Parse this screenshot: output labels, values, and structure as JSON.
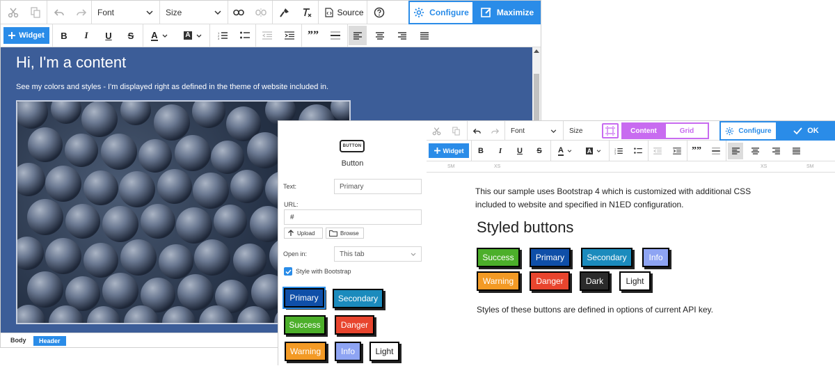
{
  "editor1": {
    "toolbar1": {
      "font_label": "Font",
      "size_label": "Size",
      "source_label": "Source",
      "configure_label": "Configure",
      "maximize_label": "Maximize"
    },
    "toolbar2": {
      "widget_label": "Widget",
      "bold": "B",
      "italic": "I",
      "underline": "U",
      "strike": "S",
      "text_color": "A",
      "bg_color": "A",
      "quote": "””"
    },
    "content": {
      "heading": "Hi, I'm a content",
      "paragraph": "See my colors and styles - I'm displayed right as defined in the theme of website included in."
    },
    "statusbar": {
      "body_label": "Body",
      "header_label": "Header"
    }
  },
  "widget_panel": {
    "icon_text": "BUTTON",
    "title": "Button",
    "text_label": "Text:",
    "text_value": "Primary",
    "url_label": "URL:",
    "url_value": "#",
    "upload_label": "Upload",
    "browse_label": "Browse",
    "open_in_label": "Open in:",
    "open_in_value": "This tab",
    "bootstrap_label": "Style with Bootstrap",
    "bootstrap_checked": true,
    "buttons": [
      {
        "label": "Primary",
        "bg": "#0f4fa8",
        "fg": "#ffffff"
      },
      {
        "label": "Secondary",
        "bg": "#1b8bbd",
        "fg": "#ffffff"
      },
      {
        "label": "Success",
        "bg": "#4caf2a",
        "fg": "#ffffff"
      },
      {
        "label": "Danger",
        "bg": "#e8452e",
        "fg": "#ffffff"
      },
      {
        "label": "Warning",
        "bg": "#f39a25",
        "fg": "#ffffff"
      },
      {
        "label": "Info",
        "bg": "#8ea4f3",
        "fg": "#ffffff"
      },
      {
        "label": "Light",
        "bg": "#ffffff",
        "fg": "#222222"
      }
    ]
  },
  "editor2": {
    "toolbar1": {
      "font_label": "Font",
      "size_label": "Size",
      "content_tab": "Content",
      "grid_tab": "Grid",
      "configure_label": "Configure",
      "ok_label": "OK"
    },
    "toolbar2": {
      "widget_label": "Widget"
    },
    "ruler": {
      "left_sm": "SM",
      "left_xs": "XS",
      "right_xs": "XS",
      "right_sm": "SM"
    },
    "content": {
      "intro": "This our sample uses Bootstrap 4 which is customized with additional CSS included to website and specified in N1ED configuration.",
      "heading": "Styled buttons",
      "footer": "Styles of these buttons are defined in options of current API key.",
      "buttons": [
        {
          "label": "Success",
          "bg": "#4caf2a",
          "fg": "#ffffff"
        },
        {
          "label": "Primary",
          "bg": "#0f4fa8",
          "fg": "#ffffff"
        },
        {
          "label": "Secondary",
          "bg": "#1b8bbd",
          "fg": "#ffffff"
        },
        {
          "label": "Info",
          "bg": "#8ea4f3",
          "fg": "#ffffff"
        },
        {
          "label": "Warning",
          "bg": "#f39a25",
          "fg": "#ffffff"
        },
        {
          "label": "Danger",
          "bg": "#e8452e",
          "fg": "#ffffff"
        },
        {
          "label": "Dark",
          "bg": "#2b2b2b",
          "fg": "#ffffff"
        },
        {
          "label": "Light",
          "bg": "#ffffff",
          "fg": "#222222"
        }
      ]
    }
  },
  "colors": {
    "accent": "#2a8ce8",
    "content_bg": "#3c5d98",
    "purple": "#c86bf0"
  }
}
